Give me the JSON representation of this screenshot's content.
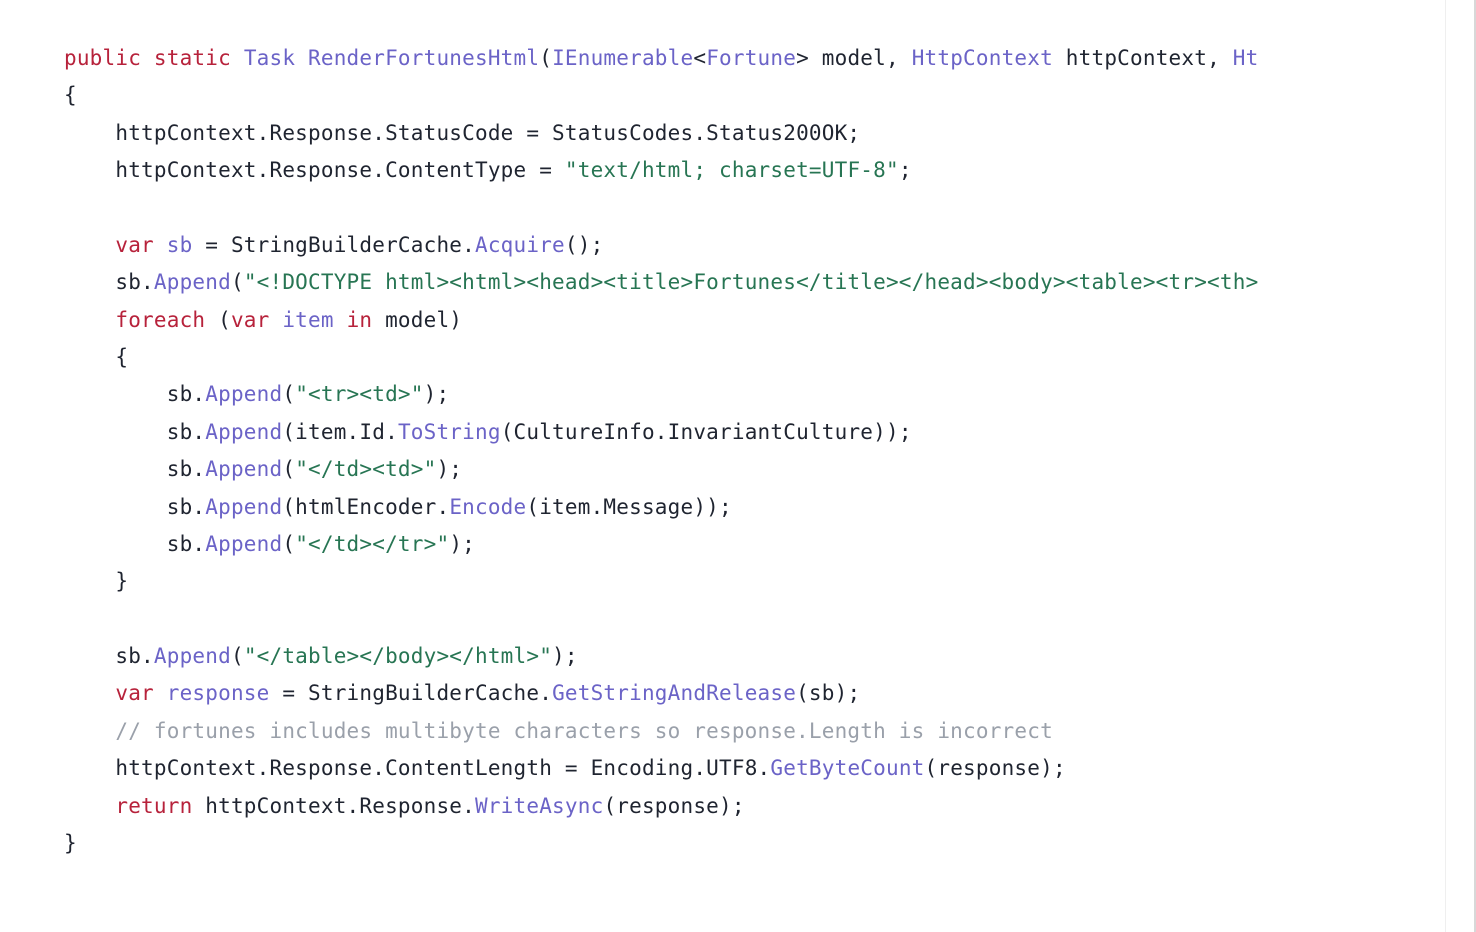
{
  "code": {
    "line1": {
      "kw1": "public",
      "kw2": "static",
      "type": "Task",
      "method": "RenderFortunesHtml",
      "p_open": "(",
      "ptype1": "IEnumerable",
      "lt": "<",
      "ptype1g": "Fortune",
      "gt": ">",
      "pname1": " model",
      "comma1": ", ",
      "ptype2": "HttpContext",
      "pname2": " httpContext",
      "comma2": ", ",
      "ptype3_frag": "Ht"
    },
    "line2": "{",
    "line3": {
      "lhs": "    httpContext.Response.StatusCode ",
      "eq": "=",
      "rhs": " StatusCodes.Status200OK;"
    },
    "line4": {
      "lhs": "    httpContext.Response.ContentType ",
      "eq": "=",
      "sp": " ",
      "str": "\"text/html; charset=UTF-8\"",
      "end": ";"
    },
    "line6": {
      "kw": "var",
      "sp1": " ",
      "id": "sb",
      "mid": " = StringBuilderCache.",
      "call": "Acquire",
      "end": "();"
    },
    "line7": {
      "lhs": "    sb.",
      "call": "Append",
      "open": "(",
      "str": "\"<!DOCTYPE html><html><head><title>Fortunes</title></head><body><table><tr><th>",
      "tail": ""
    },
    "line8": {
      "kw1": "foreach",
      "sp1": " (",
      "kw2": "var",
      "sp2": " ",
      "id": "item",
      "sp3": " ",
      "kw3": "in",
      "sp4": " model)"
    },
    "line9": "    {",
    "line10": {
      "lhs": "        sb.",
      "call": "Append",
      "open": "(",
      "str": "\"<tr><td>\"",
      "end": ");"
    },
    "line11": {
      "lhs": "        sb.",
      "call": "Append",
      "mid1": "(item.Id.",
      "call2": "ToString",
      "mid2": "(CultureInfo.InvariantCulture));"
    },
    "line12": {
      "lhs": "        sb.",
      "call": "Append",
      "open": "(",
      "str": "\"</td><td>\"",
      "end": ");"
    },
    "line13": {
      "lhs": "        sb.",
      "call": "Append",
      "mid1": "(htmlEncoder.",
      "call2": "Encode",
      "mid2": "(item.Message));"
    },
    "line14": {
      "lhs": "        sb.",
      "call": "Append",
      "open": "(",
      "str": "\"</td></tr>\"",
      "end": ");"
    },
    "line15": "    }",
    "line17": {
      "lhs": "    sb.",
      "call": "Append",
      "open": "(",
      "str": "\"</table></body></html>\"",
      "end": ");"
    },
    "line18": {
      "kw": "var",
      "sp1": " ",
      "id": "response",
      "mid": " = StringBuilderCache.",
      "call": "GetStringAndRelease",
      "end": "(sb);"
    },
    "line19": {
      "cmnt": "    // fortunes includes multibyte characters so response.Length is incorrect"
    },
    "line20": {
      "lhs": "    httpContext.Response.ContentLength ",
      "eq": "=",
      "mid": " Encoding.UTF8.",
      "call": "GetByteCount",
      "end": "(response);"
    },
    "line21": {
      "kw": "return",
      "mid": " httpContext.Response.",
      "call": "WriteAsync",
      "end": "(response);"
    },
    "line22": "}"
  }
}
